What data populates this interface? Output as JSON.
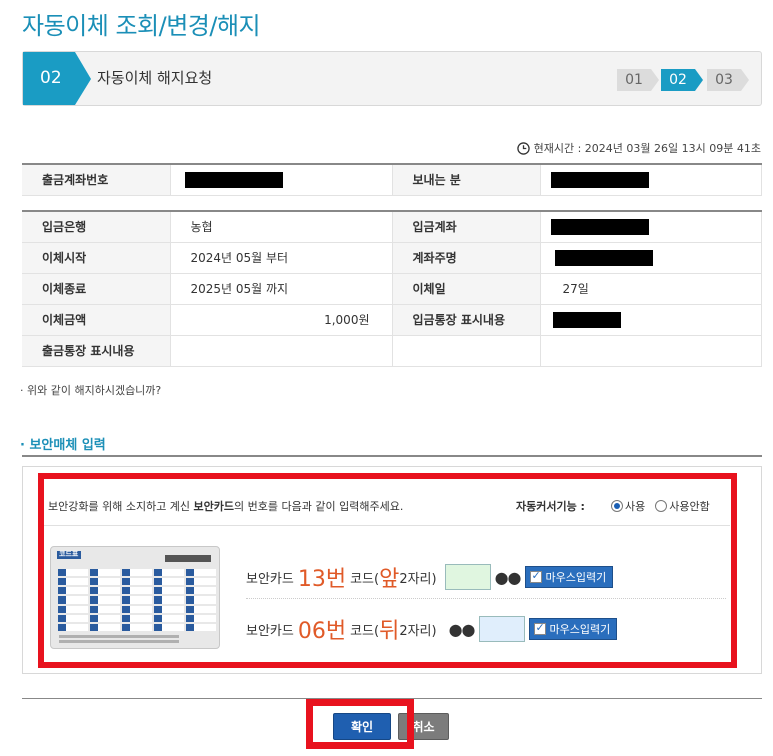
{
  "page": {
    "title": "자동이체 조회/변경/해지"
  },
  "steps": {
    "current_number": "02",
    "current_label": "자동이체 해지요청",
    "items": [
      "01",
      "02",
      "03"
    ],
    "active_index": 1
  },
  "time": {
    "text": "현재시간 : 2024년 03월 26일 13시 09분 41초"
  },
  "sender": {
    "account_label": "출금계좌번호",
    "sender_label": "보내는 분"
  },
  "details": {
    "bank_label": "입금은행",
    "bank_value": "농협",
    "deposit_account_label": "입금계좌",
    "start_label": "이체시작",
    "start_value": "2024년 05월 부터",
    "owner_label": "계좌주명",
    "end_label": "이체종료",
    "end_value": "2025년 05월 까지",
    "day_label": "이체일",
    "day_value": "27일",
    "amount_label": "이체금액",
    "amount_value": "1,000원",
    "deposit_memo_label": "입금통장 표시내용",
    "withdraw_memo_label": "출금통장 표시내용"
  },
  "question": "· 위와 같이 해지하시겠습니까?",
  "security": {
    "title": "· 보안매체 입력",
    "intro_prefix": "보안강화를 위해 소지하고 계신 ",
    "intro_bold": "보안카드",
    "intro_suffix": "의 번호를 다음과 같이 입력해주세요.",
    "auto_cursor_label": "자동커서기능 :",
    "radio_use": "사용",
    "radio_nouse": "사용안함",
    "card_label": "코드표",
    "row1": {
      "prefix": "보안카드",
      "number": "13번",
      "code": "코드(",
      "pos": "앞",
      "digits": "2자리)",
      "dots": "●●",
      "button": "마우스입력기"
    },
    "row2": {
      "prefix": "보안카드",
      "number": "06번",
      "code": "코드(",
      "pos": "뒤",
      "digits": "2자리)",
      "dots": "●●",
      "button": "마우스입력기"
    }
  },
  "buttons": {
    "confirm": "확인",
    "cancel": "취소"
  },
  "colors": {
    "accent": "#1a9cc4",
    "highlight": "#e8121e",
    "code_number": "#e05a28"
  }
}
